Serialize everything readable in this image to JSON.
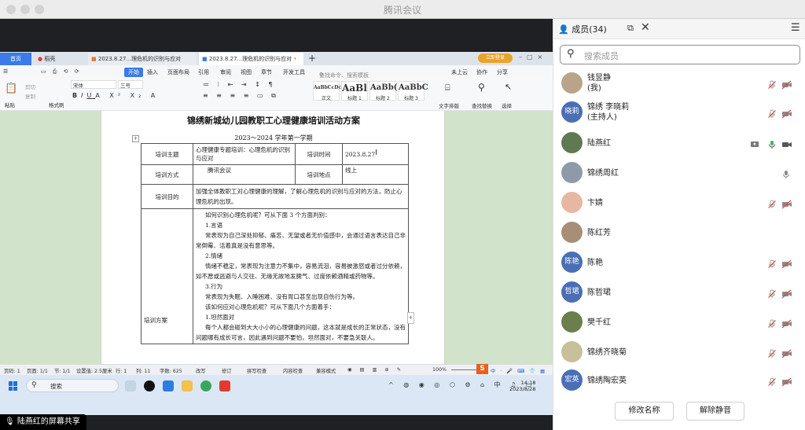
{
  "window": {
    "title": "腾讯会议"
  },
  "share_label": "陆燕红的屏幕共享",
  "wps": {
    "tabs": [
      {
        "label": "首页"
      },
      {
        "label": "稻壳"
      },
      {
        "label": "2023.8.27...理危机的识别与应对"
      },
      {
        "label": "2023.8.27...理危机的识别与应对"
      }
    ],
    "menus": [
      "开始",
      "插入",
      "页面布局",
      "引用",
      "审阅",
      "视图",
      "章节",
      "开发工具"
    ],
    "menu_right": [
      "查找命令、搜索模板",
      "未上云",
      "协作",
      "分享"
    ],
    "ribbon": {
      "paste": "粘贴",
      "cut": "剪切",
      "copy": "复制",
      "format_painter": "格式刷",
      "font": "宋体",
      "size": "三号",
      "styles": [
        {
          "sample": "AaBbCcDc",
          "name": "正文"
        },
        {
          "sample": "AaBl",
          "name": "标题 1"
        },
        {
          "sample": "AaBb(",
          "name": "标题 2"
        },
        {
          "sample": "AaBbC",
          "name": "标题 3"
        }
      ],
      "text_layout": "文字排版",
      "find_replace": "查找替换",
      "select": "选择"
    },
    "status": [
      "页码: 1",
      "页面: 1/1",
      "节: 1/1",
      "设置值: 2.5厘米",
      "行: 1",
      "列: 11",
      "字数: 625",
      "改写",
      "修订",
      "拼写检查",
      "内容检查",
      "兼容模式"
    ],
    "zoom": "100%",
    "theme_color": "#3a7be9"
  },
  "document": {
    "title": "锦绣新城幼儿园教职工心理健康培训活动方案",
    "subtitle": "2023～2024 学年第一学期",
    "table": {
      "topic_label": "培训主题",
      "topic_value": "心理健康专题培训：心理危机的识别与应对",
      "time_label": "培训时间",
      "time_value": "2023.8.27",
      "mode_label": "培训方式",
      "mode_value": "腾讯会议",
      "place_label": "培训地点",
      "place_value": "线上",
      "goal_label": "培训目的",
      "goal_value": "加强全体教职工对心理健康的理解，了解心理危机的识别与应对的方法，防止心理危机的出现。",
      "plan_label": "培训方案",
      "plan_lines": [
        "如何识别心理危机呢？可从下面 3 个方面判别：",
        "1.言语",
        "常表现为自己深处抑郁、痛苦、无望或者无价值感中，会通过语言表达自己非常倒霉、活着真是没有意思等。",
        "2.情绪",
        "情绪不稳定，常表现为注意力不集中，容易流泪，容易被激怒或者过分依赖，如不愿或逃避与人交往、无缘无故地发脾气、过度依赖酒精或药物等。",
        "3.行为",
        "常表现为失眠、入睡困难、没有胃口甚至出现自伤行为等。",
        "该如何应对心理危机呢？可从下面几个方面着手：",
        "1.坦然面对",
        "每个人都会碰到大大小小的心理健康的问题，这本就是成长的正常状态，没有问题哪有成长可言，因此遇到问题不要怕，坦然面对，不要急关联人。"
      ]
    }
  },
  "taskbar": {
    "search": "搜索",
    "time": "14:18",
    "date": "2023/8/28"
  },
  "panel": {
    "members_tab": "成员(34)",
    "search_placeholder": "搜索成员",
    "members": [
      {
        "name": "钱昱静",
        "role": "(我)",
        "avatar_text": "",
        "avatar_color": "#b9a48b",
        "mic": "muted",
        "cam": "off"
      },
      {
        "name": "锦绣 李晓莉",
        "role": "(主持人)",
        "avatar_text": "晓莉",
        "avatar_color": "#4a6fb5",
        "mic": "muted",
        "cam": "off"
      },
      {
        "name": "陆燕红",
        "role": "",
        "avatar_text": "",
        "avatar_color": "#5f7a52",
        "mic": "on",
        "cam": "on",
        "sharing": true
      },
      {
        "name": "锦绣周红",
        "role": "",
        "avatar_text": "",
        "avatar_color": "#8e9aa8",
        "mic": "on-idle",
        "cam": "none"
      },
      {
        "name": "卞婧",
        "role": "",
        "avatar_text": "",
        "avatar_color": "#e6b8a2",
        "mic": "muted",
        "cam": "off"
      },
      {
        "name": "陈红芳",
        "role": "",
        "avatar_text": "",
        "avatar_color": "#a68f76",
        "mic": "none",
        "cam": "none"
      },
      {
        "name": "陈艳",
        "role": "",
        "avatar_text": "陈艳",
        "avatar_color": "#4a6fb5",
        "mic": "muted",
        "cam": "off"
      },
      {
        "name": "陈哲珺",
        "role": "",
        "avatar_text": "哲珺",
        "avatar_color": "#4a6fb5",
        "mic": "muted",
        "cam": "off"
      },
      {
        "name": "樊千红",
        "role": "",
        "avatar_text": "",
        "avatar_color": "#6b7f4e",
        "mic": "muted",
        "cam": "off"
      },
      {
        "name": "锦绣齐晓菊",
        "role": "",
        "avatar_text": "",
        "avatar_color": "#c7c09a",
        "mic": "muted",
        "cam": "off"
      },
      {
        "name": "锦绣陶宏英",
        "role": "",
        "avatar_text": "宏英",
        "avatar_color": "#4a6fb5",
        "mic": "muted",
        "cam": "off"
      }
    ],
    "rename_button": "修改名称",
    "unmute_button": "解除静音"
  }
}
